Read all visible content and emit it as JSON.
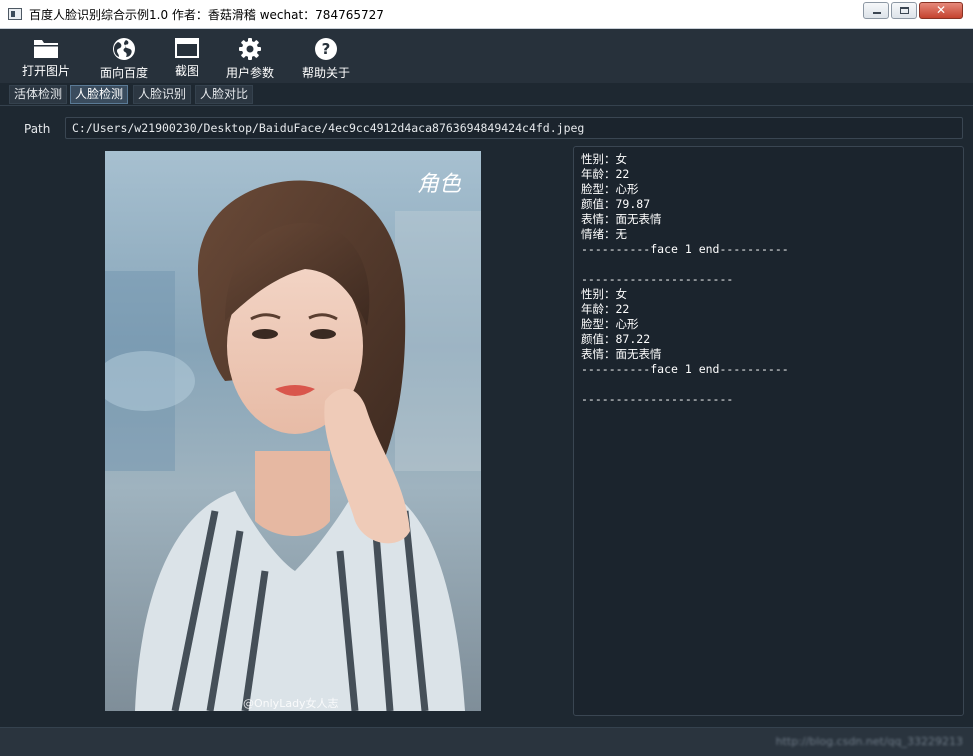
{
  "window": {
    "title": "百度人脸识别综合示例1.0 作者：香菇滑稽 wechat：784765727"
  },
  "toolbar": {
    "items": [
      {
        "label": "打开图片",
        "icon": "folder-icon"
      },
      {
        "label": "面向百度",
        "icon": "globe-icon"
      },
      {
        "label": "截图",
        "icon": "window-icon"
      },
      {
        "label": "用户参数",
        "icon": "gear-icon"
      },
      {
        "label": "帮助关于",
        "icon": "help-icon"
      }
    ]
  },
  "tabs": {
    "items": [
      {
        "label": "活体检测"
      },
      {
        "label": "人脸检测"
      },
      {
        "label": "人脸识别"
      },
      {
        "label": "人脸对比"
      }
    ],
    "active": "人脸检测"
  },
  "path": {
    "label": "Path",
    "value": "C:/Users/w21900230/Desktop/BaiduFace/4ec9cc4912d4aca8763694849424c4fd.jpeg"
  },
  "photo": {
    "watermark": "角色",
    "caption": "@OnlyLady女人志"
  },
  "result": {
    "lines": [
      "性别：女",
      "年龄：22",
      "脸型：心形",
      "颜值：79.87",
      "表情：面无表情",
      "情绪：无",
      "----------face 1 end----------",
      "",
      "----------------------",
      "性别：女",
      "年龄：22",
      "脸型：心形",
      "颜值：87.22",
      "表情：面无表情",
      "----------face 1 end----------",
      "",
      "----------------------"
    ]
  },
  "status": {
    "text": "http://blog.csdn.net/qq_33229213"
  },
  "colors": {
    "background": "#1e2831",
    "toolbar": "#27313b",
    "panel": "#1b242d",
    "text": "#ffffff"
  }
}
